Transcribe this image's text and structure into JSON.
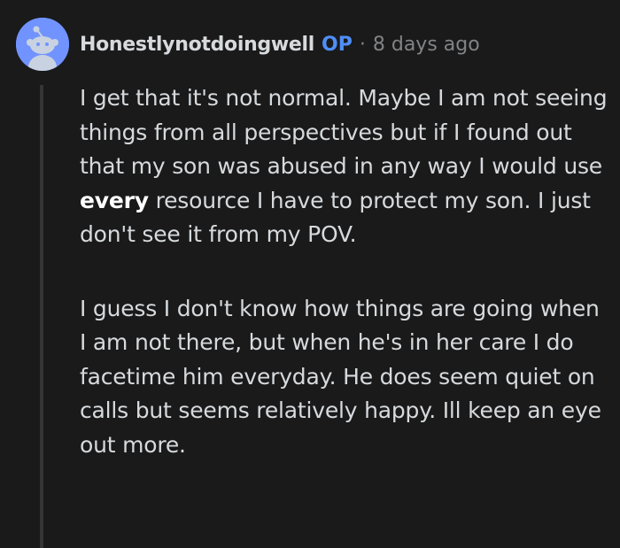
{
  "comment": {
    "author": "Honestlynotdoingwell",
    "op_badge": "OP",
    "separator": "·",
    "timestamp": "8 days ago",
    "avatar_icon": "snoo-avatar-icon",
    "colors": {
      "background": "#1a1a1b",
      "text": "#d7dadc",
      "op_badge": "#4f8ef7",
      "meta": "#818384",
      "avatar_bg": "#7193ff"
    },
    "paragraph1": {
      "before_bold": "I get that it's not normal. Maybe I am not seeing things from all perspectives but if I found out that my son was abused in any way I would use ",
      "bold": "every",
      "after_bold": " resource I have to protect my son. I just don't see it from my POV."
    },
    "paragraph2": "I guess I don't know how things are going when I am not there, but when he's in her care I do facetime him everyday. He does seem quiet on calls but seems relatively happy. Ill keep an eye out more."
  }
}
